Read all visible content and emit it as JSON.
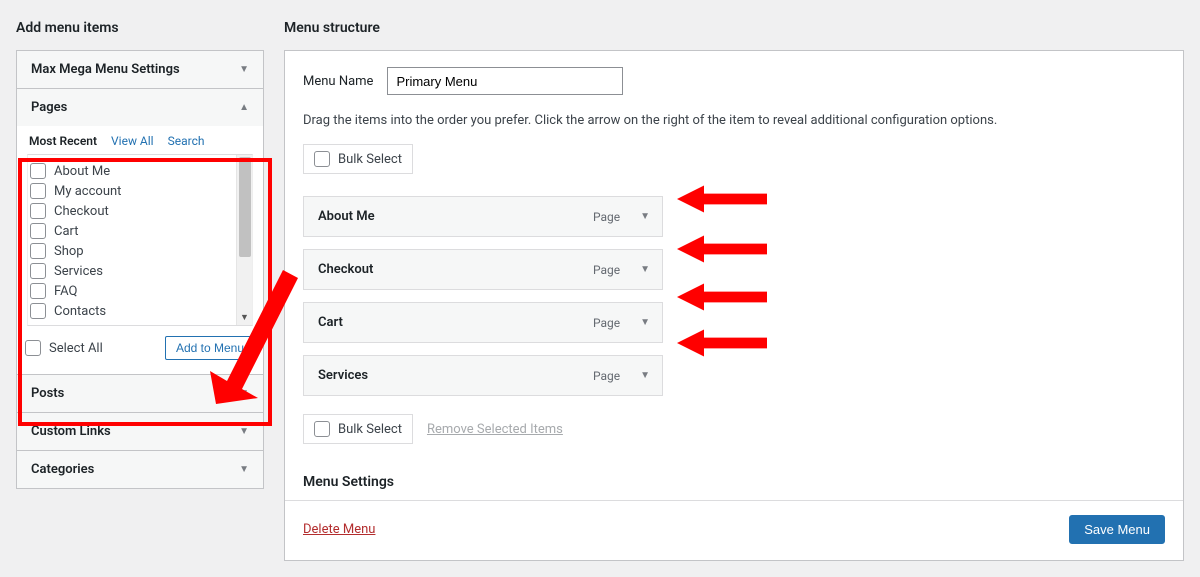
{
  "left": {
    "heading": "Add menu items",
    "accordion": [
      {
        "label": "Max Mega Menu Settings",
        "open": false
      },
      {
        "label": "Pages",
        "open": true
      },
      {
        "label": "Posts",
        "open": false
      },
      {
        "label": "Custom Links",
        "open": false
      },
      {
        "label": "Categories",
        "open": false
      }
    ],
    "tabs": [
      "Most Recent",
      "View All",
      "Search"
    ],
    "active_tab": 0,
    "pages": [
      "About Me",
      "My account",
      "Checkout",
      "Cart",
      "Shop",
      "Services",
      "FAQ",
      "Contacts"
    ],
    "select_all_label": "Select All",
    "add_to_menu_label": "Add to Menu"
  },
  "right": {
    "heading": "Menu structure",
    "menu_name_label": "Menu Name",
    "menu_name_value": "Primary Menu",
    "drag_hint": "Drag the items into the order you prefer. Click the arrow on the right of the item to reveal additional configuration options.",
    "bulk_select_label": "Bulk Select",
    "menu_items": [
      {
        "name": "About Me",
        "type": "Page"
      },
      {
        "name": "Checkout",
        "type": "Page"
      },
      {
        "name": "Cart",
        "type": "Page"
      },
      {
        "name": "Services",
        "type": "Page"
      }
    ],
    "remove_selected_label": "Remove Selected Items",
    "menu_settings_heading": "Menu Settings",
    "delete_menu_label": "Delete Menu",
    "save_menu_label": "Save Menu"
  }
}
